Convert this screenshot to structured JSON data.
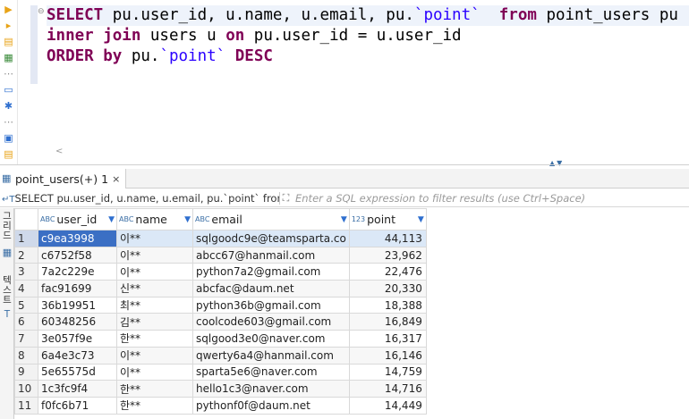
{
  "editor": {
    "sql": {
      "l1_kw1": "SELECT",
      "l1_cols": " pu.user_id, u.name, u.email, pu.",
      "l1_point": "`point`",
      "l1_kw2": "from",
      "l1_table": " point_users pu",
      "l2_kw1": "inner join",
      "l2_mid": " users u ",
      "l2_kw2": "on",
      "l2_rest": " pu.user_id = u.user_id",
      "l3_kw1": "ORDER by",
      "l3_mid": " pu.",
      "l3_point": "`point`",
      "l3_kw2": "DESC"
    },
    "scroll_left": "<"
  },
  "results_tab": {
    "label": "point_users(+) 1",
    "close": "×"
  },
  "filter": {
    "query": "SELECT pu.user_id, u.name, u.email, pu.`point` from po",
    "placeholder": "Enter a SQL expression to filter results (use Ctrl+Space)"
  },
  "sidebar": {
    "grid_label": "그리드",
    "text_label": "텍스트"
  },
  "columns": [
    {
      "type": "ABC",
      "name": "user_id"
    },
    {
      "type": "ABC",
      "name": "name"
    },
    {
      "type": "ABC",
      "name": "email"
    },
    {
      "type": "123",
      "name": "point"
    }
  ],
  "rows": [
    {
      "n": "1",
      "user_id": "c9ea3998",
      "name": "이**",
      "email": "sqlgoodc9e@teamsparta.co",
      "point": "44,113"
    },
    {
      "n": "2",
      "user_id": "c6752f58",
      "name": "이**",
      "email": "abcc67@hanmail.com",
      "point": "23,962"
    },
    {
      "n": "3",
      "user_id": "7a2c229e",
      "name": "이**",
      "email": "python7a2@gmail.com",
      "point": "22,476"
    },
    {
      "n": "4",
      "user_id": "fac91699",
      "name": "신**",
      "email": "abcfac@daum.net",
      "point": "20,330"
    },
    {
      "n": "5",
      "user_id": "36b19951",
      "name": "최**",
      "email": "python36b@gmail.com",
      "point": "18,388"
    },
    {
      "n": "6",
      "user_id": "60348256",
      "name": "김**",
      "email": "coolcode603@gmail.com",
      "point": "16,849"
    },
    {
      "n": "7",
      "user_id": "3e057f9e",
      "name": "한**",
      "email": "sqlgood3e0@naver.com",
      "point": "16,317"
    },
    {
      "n": "8",
      "user_id": "6a4e3c73",
      "name": "이**",
      "email": "qwerty6a4@hanmail.com",
      "point": "16,146"
    },
    {
      "n": "9",
      "user_id": "5e65575d",
      "name": "이**",
      "email": "sparta5e6@naver.com",
      "point": "14,759"
    },
    {
      "n": "10",
      "user_id": "1c3fc9f4",
      "name": "한**",
      "email": "hello1c3@naver.com",
      "point": "14,716"
    },
    {
      "n": "11",
      "user_id": "f0fc6b71",
      "name": "한**",
      "email": "pythonf0f@daum.net",
      "point": "14,449"
    }
  ],
  "colors": {
    "keyword": "#7f0055",
    "string": "#2a00ff",
    "selection": "#3b6fc4"
  }
}
